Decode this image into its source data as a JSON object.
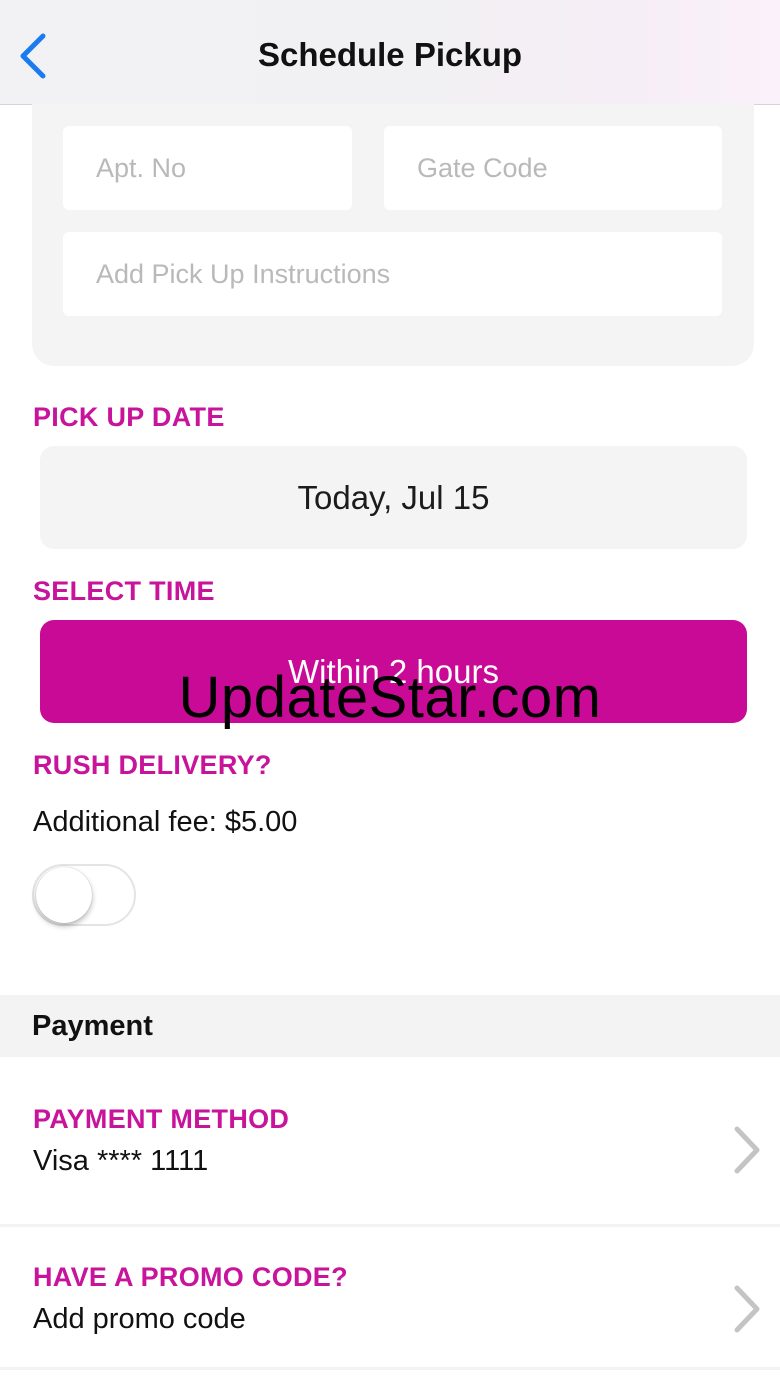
{
  "nav": {
    "title": "Schedule Pickup",
    "back_icon": "chevron-left-icon",
    "accent": "#1a7cf0"
  },
  "address": {
    "apt_placeholder": "Apt. No",
    "gate_placeholder": "Gate Code",
    "instructions_placeholder": "Add Pick Up Instructions"
  },
  "pickup_date": {
    "label": "PICK UP DATE",
    "value": "Today, Jul 15"
  },
  "select_time": {
    "label": "SELECT TIME",
    "value": "Within 2 hours"
  },
  "rush": {
    "label": "RUSH DELIVERY?",
    "fee_text": "Additional fee: $5.00",
    "enabled": false
  },
  "payment": {
    "section_title": "Payment",
    "method_label": "PAYMENT METHOD",
    "method_value": "Visa **** 1111",
    "promo_label": "HAVE A PROMO CODE?",
    "promo_value": "Add promo code"
  },
  "watermark": "UpdateStar.com",
  "colors": {
    "brand": "#c8139b",
    "button": "#c80a96",
    "field_bg": "#f4f4f4"
  }
}
